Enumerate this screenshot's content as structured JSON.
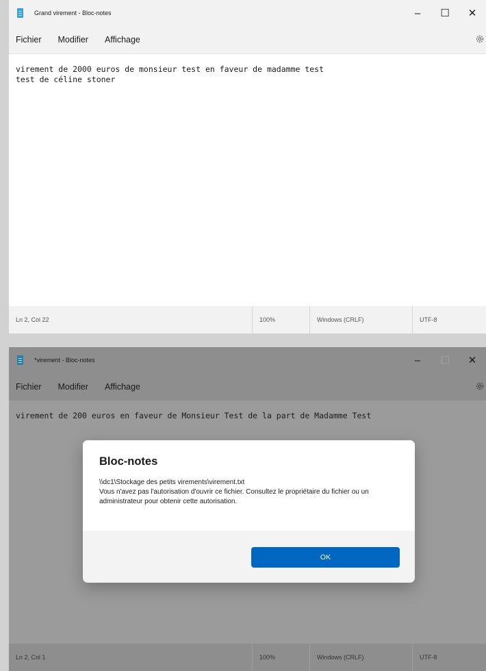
{
  "window1": {
    "title": "Grand virement - Bloc-notes",
    "controls": {
      "minimize": "–",
      "maximize": "☐",
      "close": "✕"
    },
    "menu": [
      "Fichier",
      "Modifier",
      "Affichage"
    ],
    "content_lines": [
      "virement de 2000 euros de monsieur test en faveur de madamme test",
      "test de céline stoner"
    ],
    "status": {
      "position": "Ln 2, Col 22",
      "zoom": "100%",
      "line_ending": "Windows (CRLF)",
      "encoding": "UTF-8"
    }
  },
  "window2": {
    "title": "*virement - Bloc-notes",
    "controls": {
      "minimize": "–",
      "maximize": "☐",
      "close": "✕"
    },
    "menu": [
      "Fichier",
      "Modifier",
      "Affichage"
    ],
    "content_lines": [
      "virement de 200 euros en faveur de Monsieur Test de la part de Madamme Test"
    ],
    "status": {
      "position": "Ln 2, Col 1",
      "zoom": "100%",
      "line_ending": "Windows (CRLF)",
      "encoding": "UTF-8"
    },
    "dialog": {
      "title": "Bloc-notes",
      "path": "\\\\dc1\\Stockage des petits virements\\virement.txt",
      "message": "Vous n'avez pas l'autorisation d'ouvrir ce fichier. Consultez le propriétaire du fichier ou un administrateur pour obtenir cette autorisation.",
      "ok_label": "OK"
    }
  },
  "icons": {
    "app": "notepad-icon",
    "settings": "gear-icon"
  },
  "colors": {
    "accent": "#0067c0",
    "app_icon": "#3aa0d8"
  }
}
